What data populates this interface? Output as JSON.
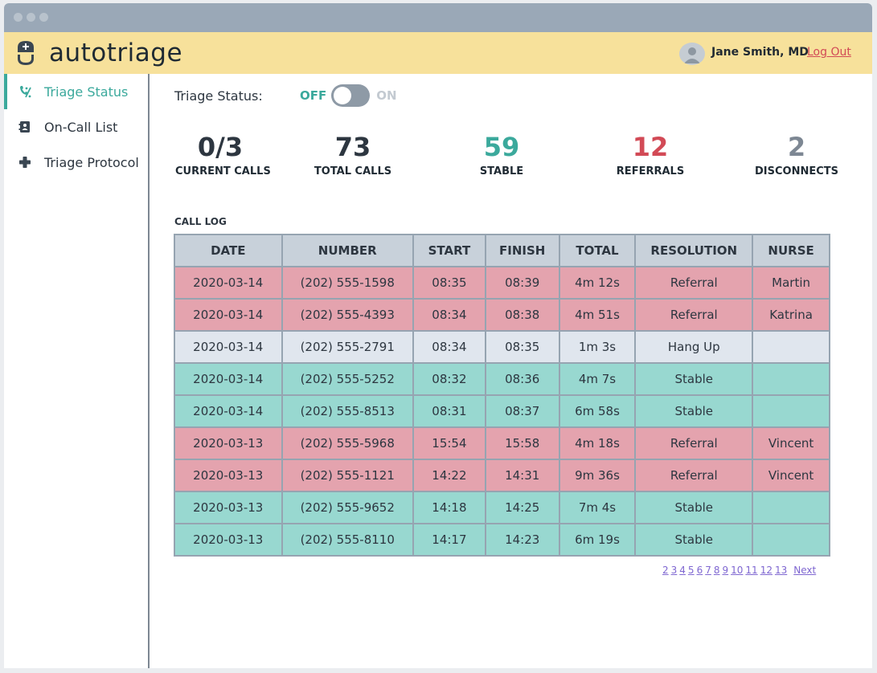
{
  "app": {
    "title": "autotriage"
  },
  "user": {
    "name": "Jane Smith, MD",
    "logout_label": "Log Out"
  },
  "sidebar": {
    "items": [
      {
        "label": "Triage Status",
        "icon": "phone-slash-icon",
        "active": true
      },
      {
        "label": "On-Call List",
        "icon": "contact-card-icon",
        "active": false
      },
      {
        "label": "Triage Protocol",
        "icon": "plus-icon",
        "active": false
      }
    ]
  },
  "triage": {
    "label": "Triage Status:",
    "off_label": "OFF",
    "on_label": "ON",
    "state": "off"
  },
  "stats": {
    "current": {
      "value": "0/3",
      "label": "CURRENT CALLS"
    },
    "total": {
      "value": "73",
      "label": "TOTAL CALLS"
    },
    "stable": {
      "value": "59",
      "label": "STABLE"
    },
    "referrals": {
      "value": "12",
      "label": "REFERRALS"
    },
    "disconnects": {
      "value": "2",
      "label": "DISCONNECTS"
    }
  },
  "colors": {
    "accent": "#3ba99c",
    "referral": "#d24a56",
    "neutral": "#7d8793",
    "header_bg": "#f7e19b"
  },
  "call_log": {
    "title": "CALL LOG",
    "columns": [
      "DATE",
      "NUMBER",
      "START",
      "FINISH",
      "TOTAL",
      "RESOLUTION",
      "NURSE"
    ],
    "rows": [
      {
        "type": "referral",
        "cells": [
          "2020-03-14",
          "(202) 555-1598",
          "08:35",
          "08:39",
          "4m 12s",
          "Referral",
          "Martin"
        ]
      },
      {
        "type": "referral",
        "cells": [
          "2020-03-14",
          "(202) 555-4393",
          "08:34",
          "08:38",
          "4m 51s",
          "Referral",
          "Katrina"
        ]
      },
      {
        "type": "hangup",
        "cells": [
          "2020-03-14",
          "(202) 555-2791",
          "08:34",
          "08:35",
          "1m 3s",
          "Hang Up",
          ""
        ]
      },
      {
        "type": "stable",
        "cells": [
          "2020-03-14",
          "(202) 555-5252",
          "08:32",
          "08:36",
          "4m 7s",
          "Stable",
          ""
        ]
      },
      {
        "type": "stable",
        "cells": [
          "2020-03-14",
          "(202) 555-8513",
          "08:31",
          "08:37",
          "6m 58s",
          "Stable",
          ""
        ]
      },
      {
        "type": "referral",
        "cells": [
          "2020-03-13",
          "(202) 555-5968",
          "15:54",
          "15:58",
          "4m 18s",
          "Referral",
          "Vincent"
        ]
      },
      {
        "type": "referral",
        "cells": [
          "2020-03-13",
          "(202) 555-1121",
          "14:22",
          "14:31",
          "9m 36s",
          "Referral",
          "Vincent"
        ]
      },
      {
        "type": "stable",
        "cells": [
          "2020-03-13",
          "(202) 555-9652",
          "14:18",
          "14:25",
          "7m 4s",
          "Stable",
          ""
        ]
      },
      {
        "type": "stable",
        "cells": [
          "2020-03-13",
          "(202) 555-8110",
          "14:17",
          "14:23",
          "6m 19s",
          "Stable",
          ""
        ]
      }
    ]
  },
  "pagination": {
    "pages": [
      "2",
      "3",
      "4",
      "5",
      "6",
      "7",
      "8",
      "9",
      "10",
      "11",
      "12",
      "13"
    ],
    "next_label": "Next"
  }
}
